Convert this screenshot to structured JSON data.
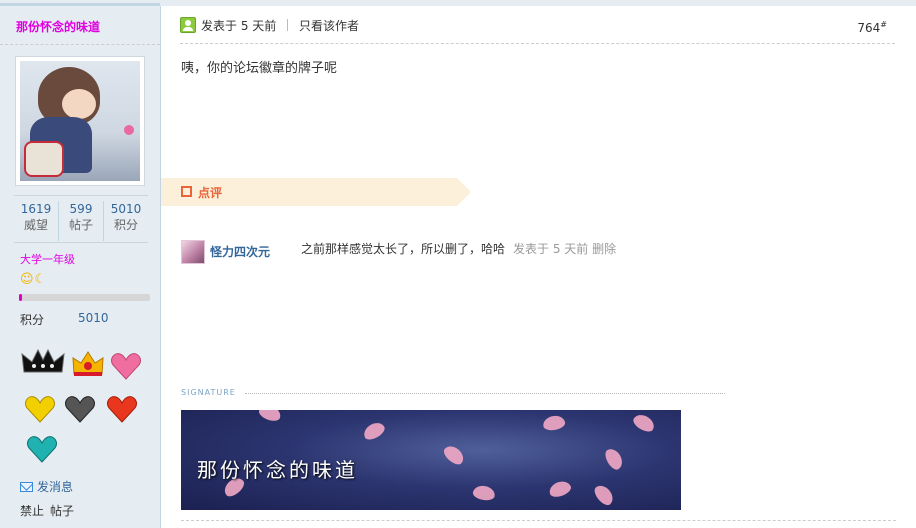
{
  "sidebar": {
    "username": "那份怀念的味道",
    "stats": [
      {
        "value": "1619",
        "label": "威望"
      },
      {
        "value": "599",
        "label": "帖子"
      },
      {
        "value": "5010",
        "label": "积分"
      }
    ],
    "grade": "大学一年级",
    "grade_icons": "☺☾",
    "progress_fraction": 0.02,
    "points_label": "积分",
    "points_value": "5010",
    "medals": [
      "black-crown-icon",
      "gold-crown-icon",
      "pink-heart-icon",
      "gold-heart-icon",
      "silver-heart-icon",
      "red-heart-icon",
      "teal-heart-icon"
    ],
    "message_label": "发消息",
    "ban_labels": [
      "禁止",
      "帖子"
    ]
  },
  "post": {
    "posted_label": "发表于 5 天前",
    "only_author_label": "只看该作者",
    "floor": "764",
    "floor_mark": "#",
    "body": "咦，你的论坛徽章的牌子呢"
  },
  "comments": {
    "header": "点评",
    "items": [
      {
        "user": "怪力四次元",
        "text": "之前那样感觉太长了，所以删了，哈哈",
        "meta": "发表于 5 天前 删除"
      }
    ]
  },
  "signature": {
    "label": "SIGNATURE",
    "image_text": "那份怀念的味道"
  },
  "colors": {
    "username": "#e000e0",
    "link": "#336699",
    "sidebar_bg": "#e5edf2",
    "comment_accent": "#e8643a"
  }
}
